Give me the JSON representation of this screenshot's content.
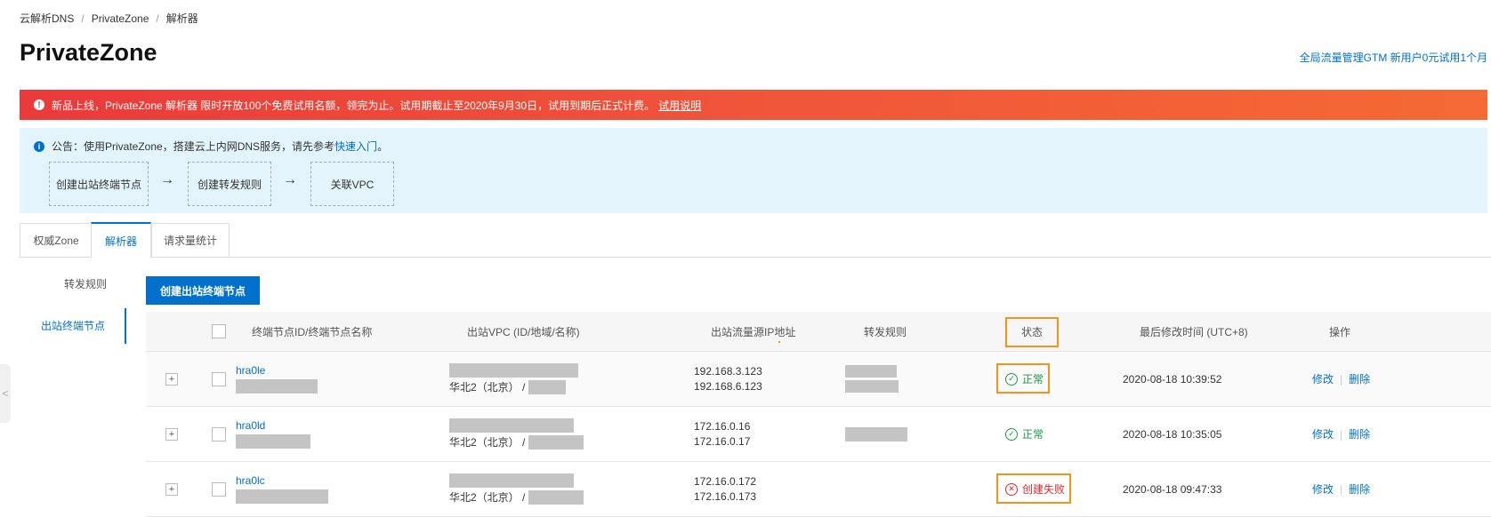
{
  "breadcrumb": [
    "云解析DNS",
    "PrivateZone",
    "解析器"
  ],
  "breadcrumb_sep": "/",
  "page_title": "PrivateZone",
  "top_link": "全局流量管理GTM 新用户0元试用1个月",
  "banner": {
    "icon": "info-icon",
    "text": "新品上线，PrivateZone 解析器 限时开放100个免费试用名额，领完为止。试用期截止至2020年9月30日，试用到期后正式计费。",
    "link": "试用说明",
    "color_start": "#ea3a3b",
    "color_end": "#f56a34"
  },
  "notice": {
    "prefix": "公告：使用PrivateZone，搭建云上内网DNS服务，请先参考",
    "link": "快速入门",
    "suffix": "。",
    "steps": [
      "创建出站终端节点",
      "创建转发规则",
      "关联VPC"
    ]
  },
  "tabs": [
    "权威Zone",
    "解析器",
    "请求量统计"
  ],
  "active_tab": "解析器",
  "side_nav": [
    "转发规则",
    "出站终端节点"
  ],
  "active_side_nav": "出站终端节点",
  "create_button": "创建出站终端节点",
  "table": {
    "headers": {
      "id": "终端节点ID/终端节点名称",
      "vpc": "出站VPC (ID/地域/名称)",
      "ip": "出站流量源IP地址",
      "rules": "转发规则",
      "status": "状态",
      "modified": "最后修改时间 (UTC+8)",
      "ops": "操作"
    },
    "rows": [
      {
        "id": "hra0le",
        "vpc_region": "华北2（北京） /",
        "ips": [
          "192.168.3.123",
          "192.168.6.123"
        ],
        "status": "正常",
        "status_type": "ok",
        "modified": "2020-08-18 10:39:52",
        "edit": "修改",
        "delete": "删除"
      },
      {
        "id": "hra0ld",
        "vpc_region": "华北2（北京） /",
        "ips": [
          "172.16.0.16",
          "172.16.0.17"
        ],
        "status": "正常",
        "status_type": "ok",
        "modified": "2020-08-18 10:35:05",
        "edit": "修改",
        "delete": "删除"
      },
      {
        "id": "hra0lc",
        "vpc_region": "华北2（北京） /",
        "ips": [
          "172.16.0.172",
          "172.16.0.173"
        ],
        "status": "创建失败",
        "status_type": "fail",
        "modified": "2020-08-18 09:47:33",
        "edit": "修改",
        "delete": "删除"
      }
    ]
  },
  "colors": {
    "accent": "#0070cc",
    "ok": "#1b9a44",
    "fail": "#e0282e",
    "highlight": "#f0951c",
    "notice_bg": "#e3f4fc"
  }
}
